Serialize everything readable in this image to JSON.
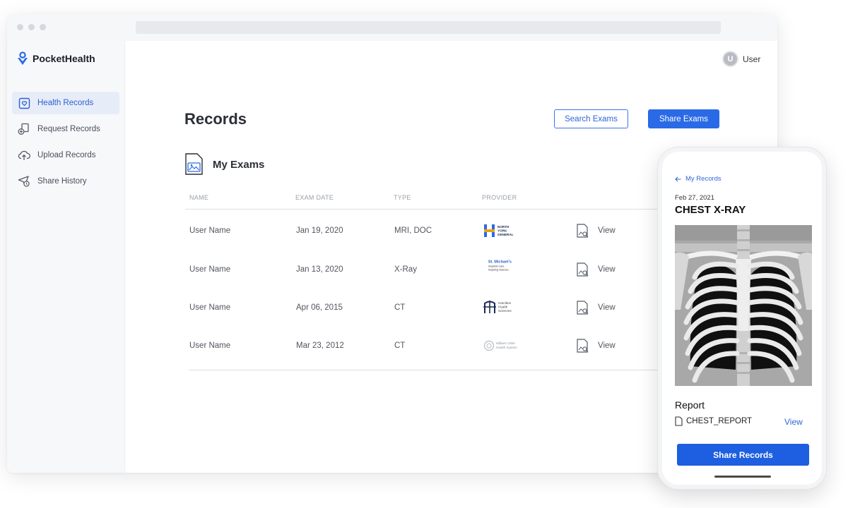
{
  "app": {
    "name": "PocketHealth",
    "brand_color": "#2a6ae6",
    "user_initial": "U",
    "user_name": "User"
  },
  "sidebar": {
    "items": [
      {
        "label": "Health Records",
        "icon": "health-records-icon",
        "active": true
      },
      {
        "label": "Request Records",
        "icon": "request-records-icon",
        "active": false
      },
      {
        "label": "Upload Records",
        "icon": "upload-cloud-icon",
        "active": false
      },
      {
        "label": "Share History",
        "icon": "share-history-icon",
        "active": false
      }
    ]
  },
  "main": {
    "title": "Records",
    "search_button": "Search Exams",
    "share_button": "Share Exams",
    "section_title": "My Exams",
    "table": {
      "columns": [
        "NAME",
        "EXAM DATE",
        "TYPE",
        "PROVIDER"
      ],
      "rows": [
        {
          "name": "User Name",
          "date": "Jan 19, 2020",
          "type": "MRI, DOC",
          "provider_lines": [
            "NORTH",
            "YORK",
            "GENERAL"
          ],
          "view": "View"
        },
        {
          "name": "User Name",
          "date": "Jan 13, 2020",
          "type": "X-Ray",
          "provider_lines": [
            "St. Michael's",
            "Inspired Care.",
            "Inspiring Science."
          ],
          "view": "View"
        },
        {
          "name": "User Name",
          "date": "Apr 06, 2015",
          "type": "CT",
          "provider_lines": [
            "Hamilton",
            "Health",
            "Sciences"
          ],
          "view": "View"
        },
        {
          "name": "User Name",
          "date": "Mar 23, 2012",
          "type": "CT",
          "provider_lines": [
            "William Osler",
            "Health System"
          ],
          "view": "View"
        }
      ]
    }
  },
  "phone": {
    "back_label": "My Records",
    "date": "Feb 27, 2021",
    "title": "CHEST X-RAY",
    "report_label": "Report",
    "report_file": "CHEST_REPORT",
    "report_view": "View",
    "share_button": "Share Records"
  }
}
